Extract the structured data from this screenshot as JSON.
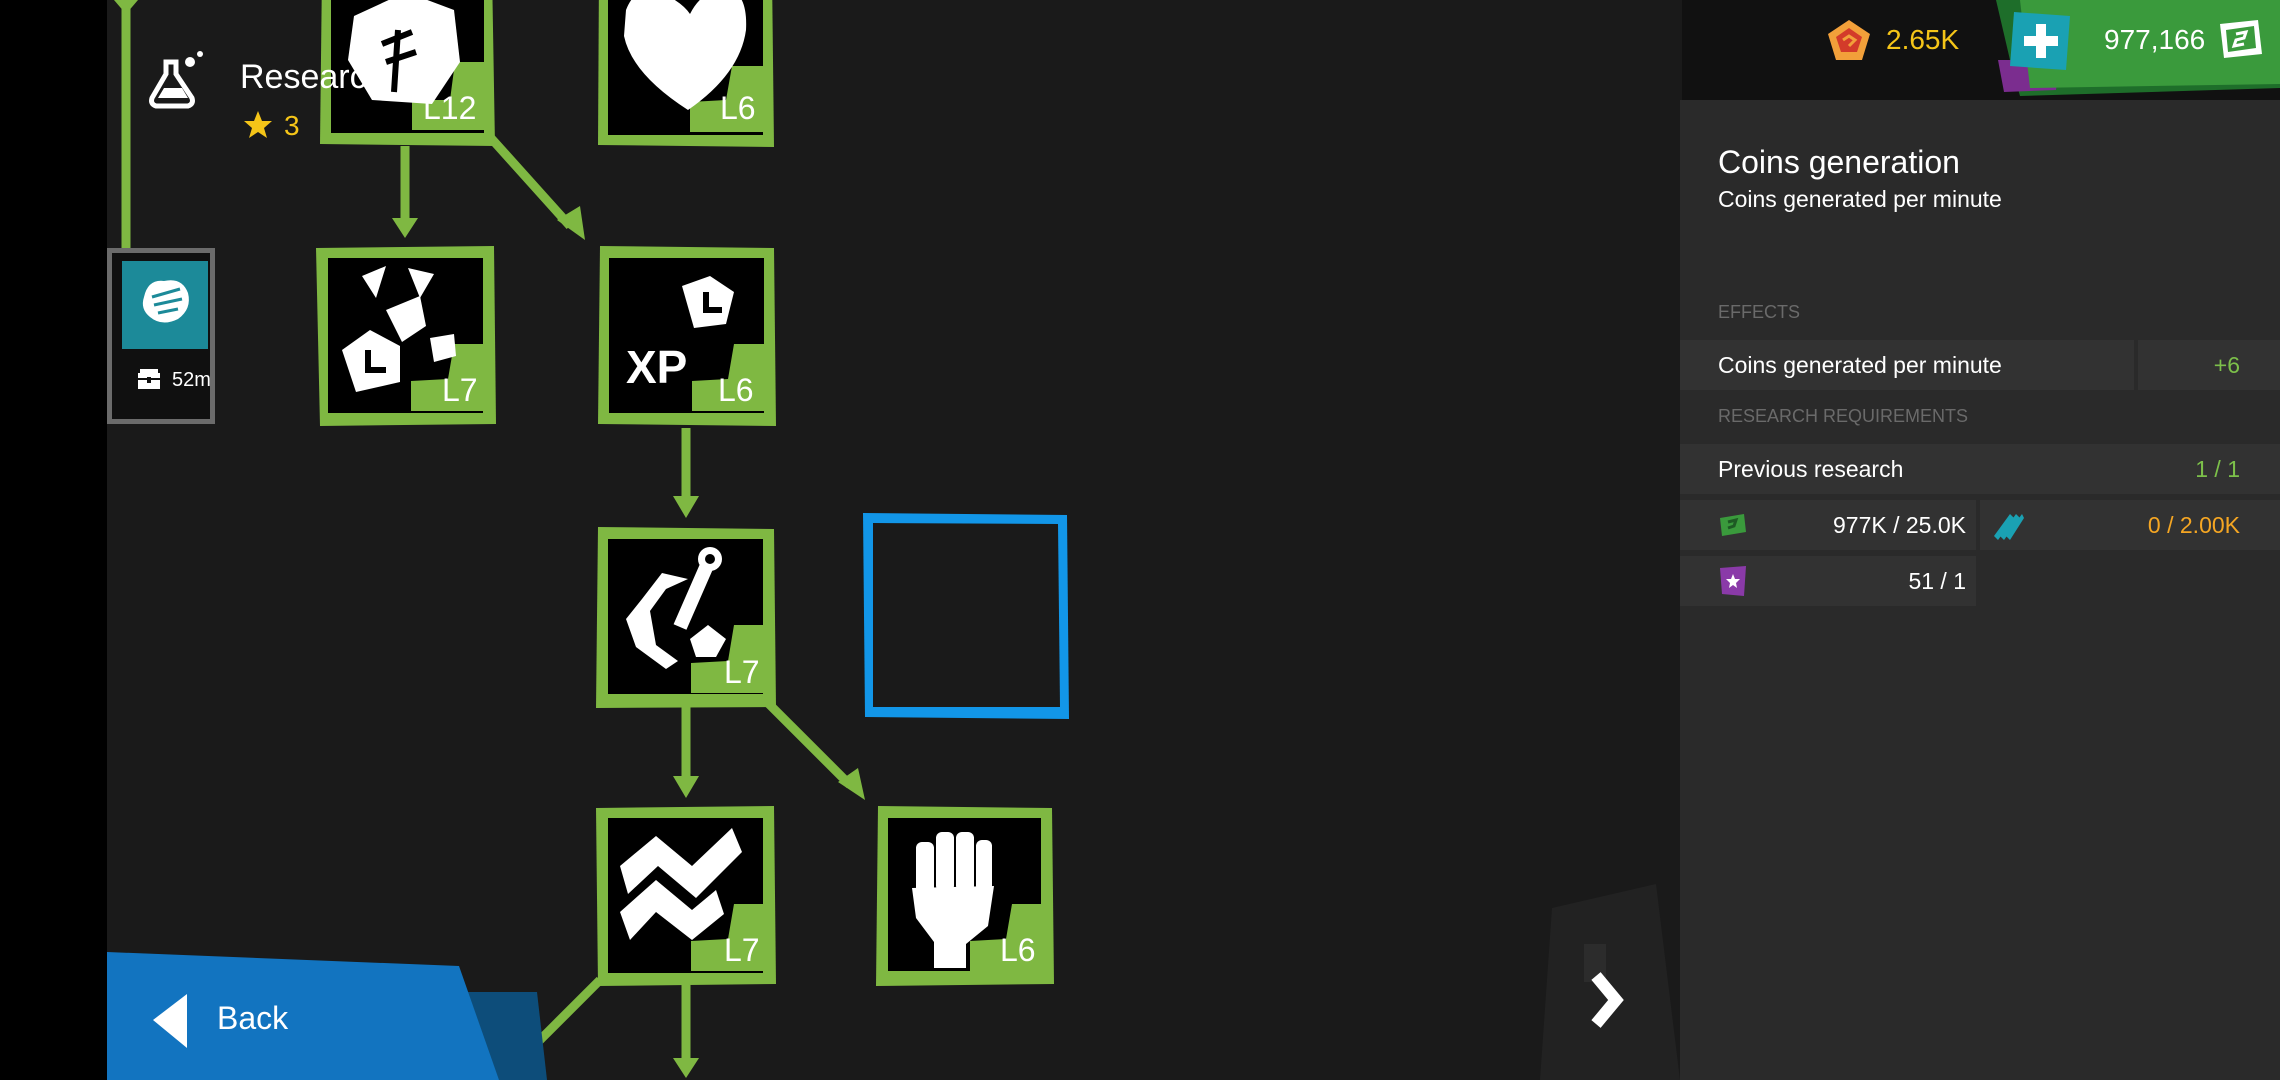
{
  "header": {
    "title": "Research",
    "star_count": "3"
  },
  "currency": {
    "gems": "2.65K",
    "coins": "977,166",
    "add_label": "+"
  },
  "tree": {
    "nodes": [
      {
        "key": "top-left",
        "icon": "scribble-icon",
        "level": "L12"
      },
      {
        "key": "top-right",
        "icon": "heart-icon",
        "level": "L6"
      },
      {
        "key": "mid-left",
        "icon": "rocks-clock-icon",
        "level": "L7"
      },
      {
        "key": "mid-right",
        "icon": "xp-clock-icon",
        "level": "L6",
        "extra": "XP"
      },
      {
        "key": "center",
        "icon": "wrench-gear-icon",
        "level": "L7"
      },
      {
        "key": "bottom-center",
        "icon": "zigzag-icon",
        "level": "L7"
      },
      {
        "key": "bottom-right",
        "icon": "fist-icon",
        "level": "L6"
      }
    ],
    "side_node": {
      "icon": "fist-handshake-icon",
      "timer": "52m"
    }
  },
  "panel": {
    "title": "Coins generation",
    "subtitle": "Coins generated per minute",
    "effects_header": "EFFECTS",
    "effect": {
      "label": "Coins generated per minute",
      "value": "+6"
    },
    "requirements_header": "RESEARCH REQUIREMENTS",
    "previous": {
      "label": "Previous research",
      "value": "1 / 1"
    },
    "costs": [
      {
        "icon": "cash-icon",
        "value": "977K / 25.0K"
      },
      {
        "icon": "cards-icon",
        "value": "0 / 2.00K"
      },
      {
        "icon": "purple-card-icon",
        "value": "51 / 1"
      }
    ]
  },
  "nav": {
    "back_label": "Back"
  },
  "colors": {
    "green": "#7fb842",
    "blue": "#1296e8",
    "panel": "#2a2a2a",
    "gold": "#f5c518",
    "orange": "#f5a623",
    "positive": "#7cc04a"
  }
}
